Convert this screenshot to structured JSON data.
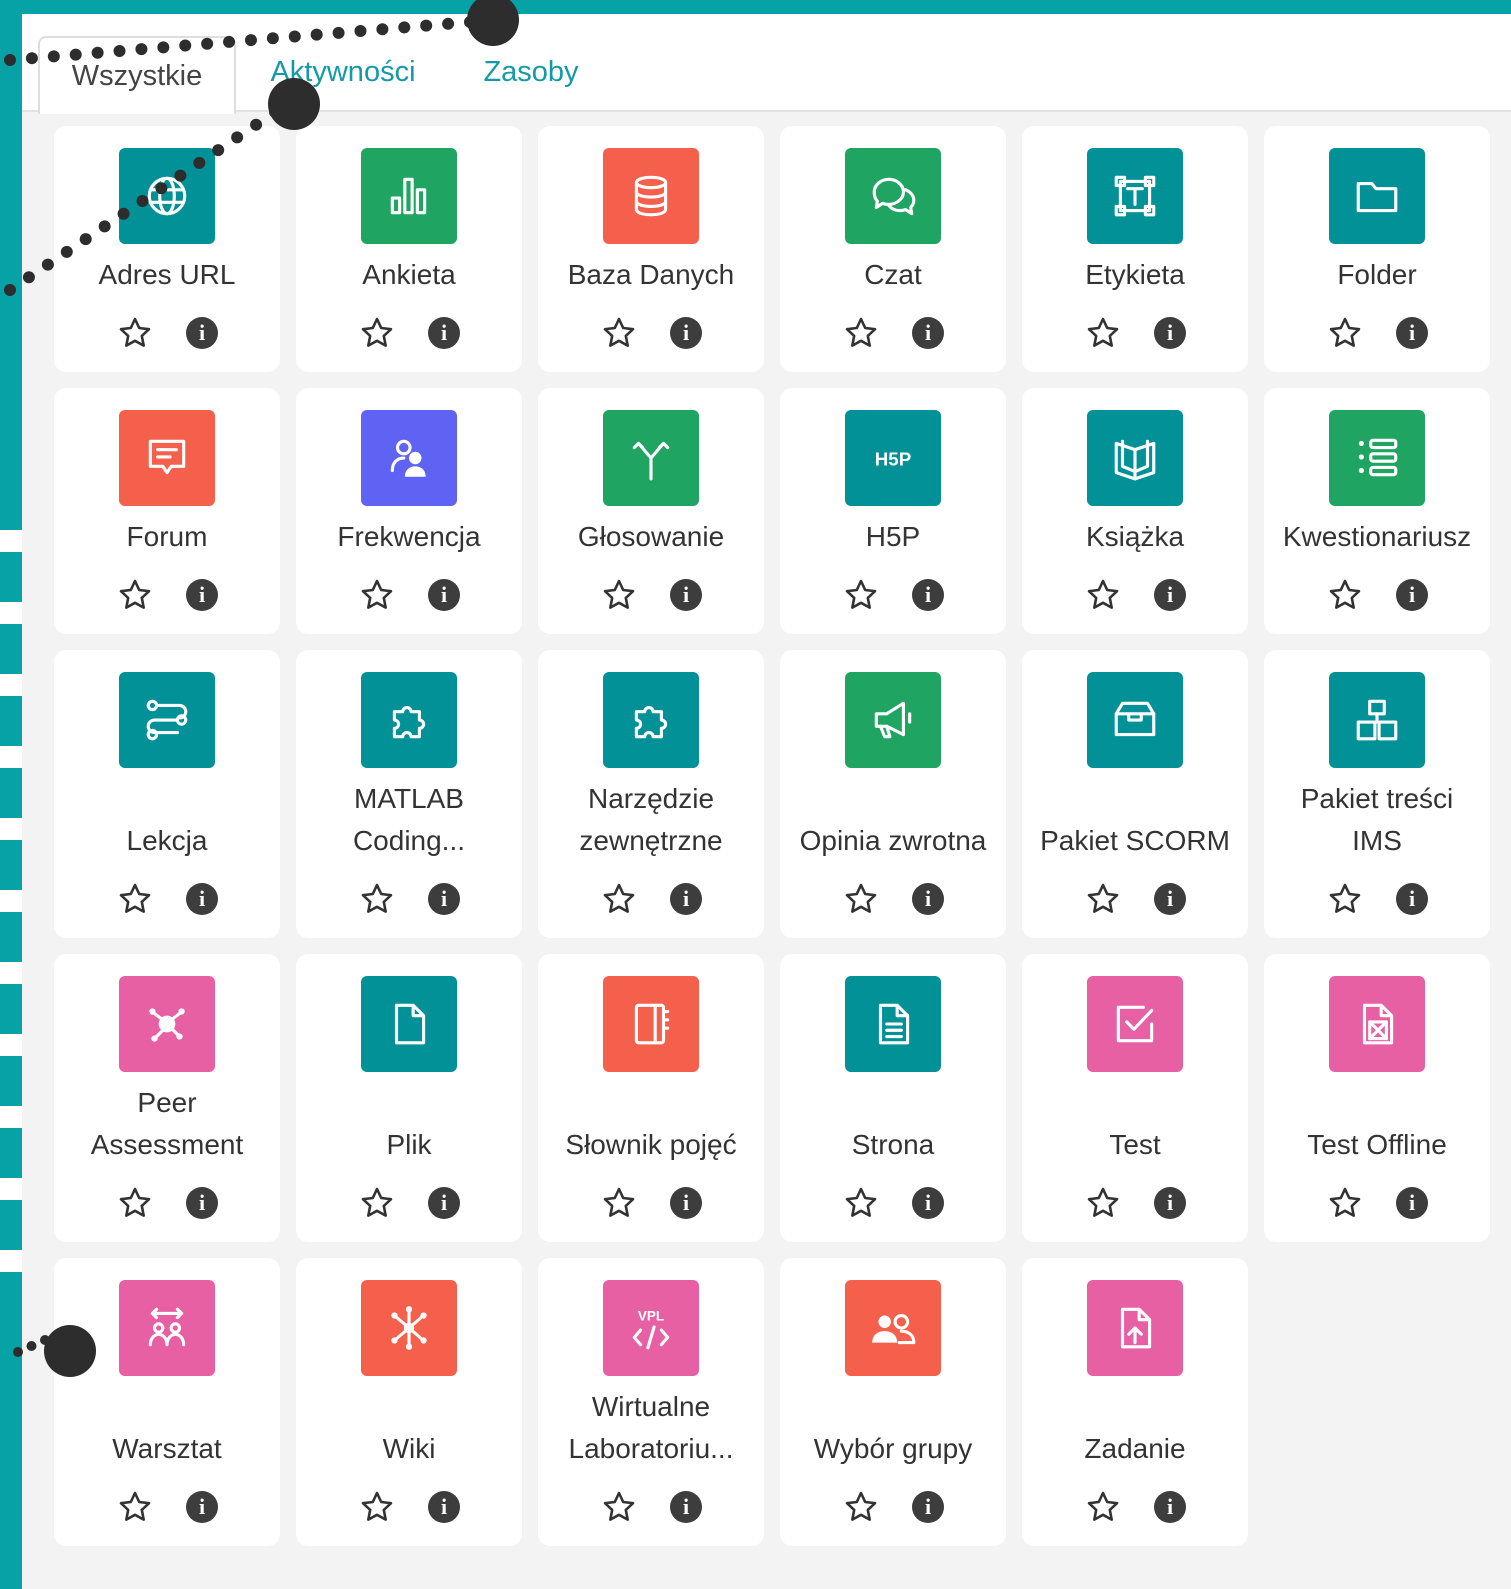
{
  "tabs": [
    {
      "label": "Wszystkie",
      "active": true
    },
    {
      "label": "Aktywności",
      "active": false
    },
    {
      "label": "Zasoby",
      "active": false
    }
  ],
  "colors": {
    "teal": "#039198",
    "green": "#20a462",
    "orange": "#f5604c",
    "purple": "#5f63f3",
    "pink": "#e860a4",
    "frame": "#06a2a6"
  },
  "modules": [
    {
      "name": "Adres URL",
      "color": "teal",
      "icon": "globe-icon"
    },
    {
      "name": "Ankieta",
      "color": "green",
      "icon": "bar-chart-icon"
    },
    {
      "name": "Baza Danych",
      "color": "orange",
      "icon": "database-icon"
    },
    {
      "name": "Czat",
      "color": "green",
      "icon": "chat-icon"
    },
    {
      "name": "Etykieta",
      "color": "teal",
      "icon": "text-label-icon"
    },
    {
      "name": "Folder",
      "color": "teal",
      "icon": "folder-icon"
    },
    {
      "name": "Forum",
      "color": "orange",
      "icon": "message-icon"
    },
    {
      "name": "Frekwencja",
      "color": "purple",
      "icon": "attendance-icon"
    },
    {
      "name": "Głosowanie",
      "color": "green",
      "icon": "choice-icon"
    },
    {
      "name": "H5P",
      "color": "teal",
      "icon": "h5p-icon"
    },
    {
      "name": "Książka",
      "color": "teal",
      "icon": "book-icon"
    },
    {
      "name": "Kwestionariusz",
      "color": "green",
      "icon": "list-icon"
    },
    {
      "name": "Lekcja",
      "color": "teal",
      "icon": "path-icon"
    },
    {
      "name": "MATLAB Coding...",
      "color": "teal",
      "icon": "puzzle-icon"
    },
    {
      "name": "Narzędzie zewnętrzne",
      "color": "teal",
      "icon": "puzzle-icon"
    },
    {
      "name": "Opinia zwrotna",
      "color": "green",
      "icon": "megaphone-icon"
    },
    {
      "name": "Pakiet SCORM",
      "color": "teal",
      "icon": "box-icon"
    },
    {
      "name": "Pakiet treści IMS",
      "color": "teal",
      "icon": "boxes-icon"
    },
    {
      "name": "Peer Assessment",
      "color": "pink",
      "icon": "peer-assessment-icon"
    },
    {
      "name": "Plik",
      "color": "teal",
      "icon": "file-icon"
    },
    {
      "name": "Słownik pojęć",
      "color": "orange",
      "icon": "glossary-icon"
    },
    {
      "name": "Strona",
      "color": "teal",
      "icon": "page-icon"
    },
    {
      "name": "Test",
      "color": "pink",
      "icon": "quiz-icon"
    },
    {
      "name": "Test Offline",
      "color": "pink",
      "icon": "offline-quiz-icon"
    },
    {
      "name": "Warsztat",
      "color": "pink",
      "icon": "workshop-icon"
    },
    {
      "name": "Wiki",
      "color": "orange",
      "icon": "wiki-icon"
    },
    {
      "name": "Wirtualne Laboratoriu...",
      "color": "pink",
      "icon": "vpl-icon"
    },
    {
      "name": "Wybór grupy",
      "color": "orange",
      "icon": "group-choice-icon"
    },
    {
      "name": "Zadanie",
      "color": "pink",
      "icon": "assignment-icon"
    }
  ]
}
